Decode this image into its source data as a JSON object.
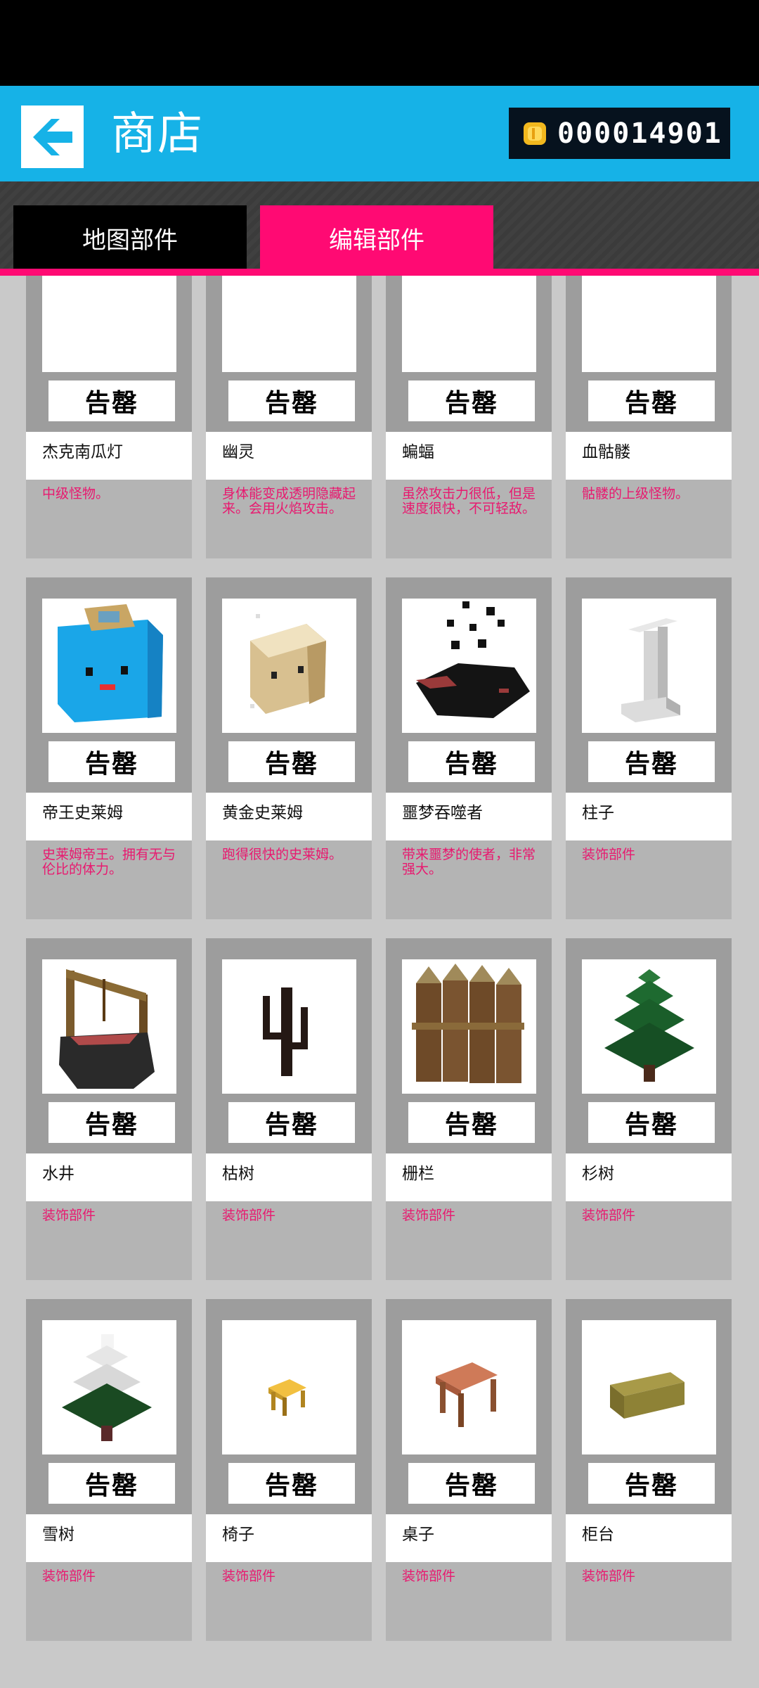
{
  "header": {
    "title": "商店",
    "coins": "000014901"
  },
  "tabs": [
    {
      "label": "地图部件",
      "active": false
    },
    {
      "label": "编辑部件",
      "active": true
    }
  ],
  "colors": {
    "accent": "#ff0a73",
    "header": "#16b2e7",
    "desc_text": "#e8196f"
  },
  "items": [
    {
      "name": "杰克南瓜灯",
      "button": "告罄",
      "desc": "中级怪物。",
      "icon": "pumpkin-lantern-icon"
    },
    {
      "name": "幽灵",
      "button": "告罄",
      "desc": "身体能变成透明隐藏起来。会用火焰攻击。",
      "icon": "ghost-icon"
    },
    {
      "name": "蝙蝠",
      "button": "告罄",
      "desc": "虽然攻击力很低，但是速度很快，不可轻敌。",
      "icon": "bat-icon"
    },
    {
      "name": "血骷髅",
      "button": "告罄",
      "desc": "骷髅的上级怪物。",
      "icon": "blood-skeleton-icon"
    },
    {
      "name": "帝王史莱姆",
      "button": "告罄",
      "desc": "史莱姆帝王。拥有无与伦比的体力。",
      "icon": "king-slime-icon"
    },
    {
      "name": "黄金史莱姆",
      "button": "告罄",
      "desc": "跑得很快的史莱姆。",
      "icon": "golden-slime-icon"
    },
    {
      "name": "噩梦吞噬者",
      "button": "告罄",
      "desc": "带来噩梦的使者，非常强大。",
      "icon": "nightmare-eater-icon"
    },
    {
      "name": "柱子",
      "button": "告罄",
      "desc": "装饰部件",
      "icon": "pillar-icon"
    },
    {
      "name": "水井",
      "button": "告罄",
      "desc": "装饰部件",
      "icon": "well-icon"
    },
    {
      "name": "枯树",
      "button": "告罄",
      "desc": "装饰部件",
      "icon": "dead-tree-icon"
    },
    {
      "name": "栅栏",
      "button": "告罄",
      "desc": "装饰部件",
      "icon": "fence-icon"
    },
    {
      "name": "杉树",
      "button": "告罄",
      "desc": "装饰部件",
      "icon": "fir-tree-icon"
    },
    {
      "name": "雪树",
      "button": "告罄",
      "desc": "装饰部件",
      "icon": "snow-tree-icon"
    },
    {
      "name": "椅子",
      "button": "告罄",
      "desc": "装饰部件",
      "icon": "chair-icon"
    },
    {
      "name": "桌子",
      "button": "告罄",
      "desc": "装饰部件",
      "icon": "table-icon"
    },
    {
      "name": "柜台",
      "button": "告罄",
      "desc": "装饰部件",
      "icon": "counter-icon"
    }
  ]
}
